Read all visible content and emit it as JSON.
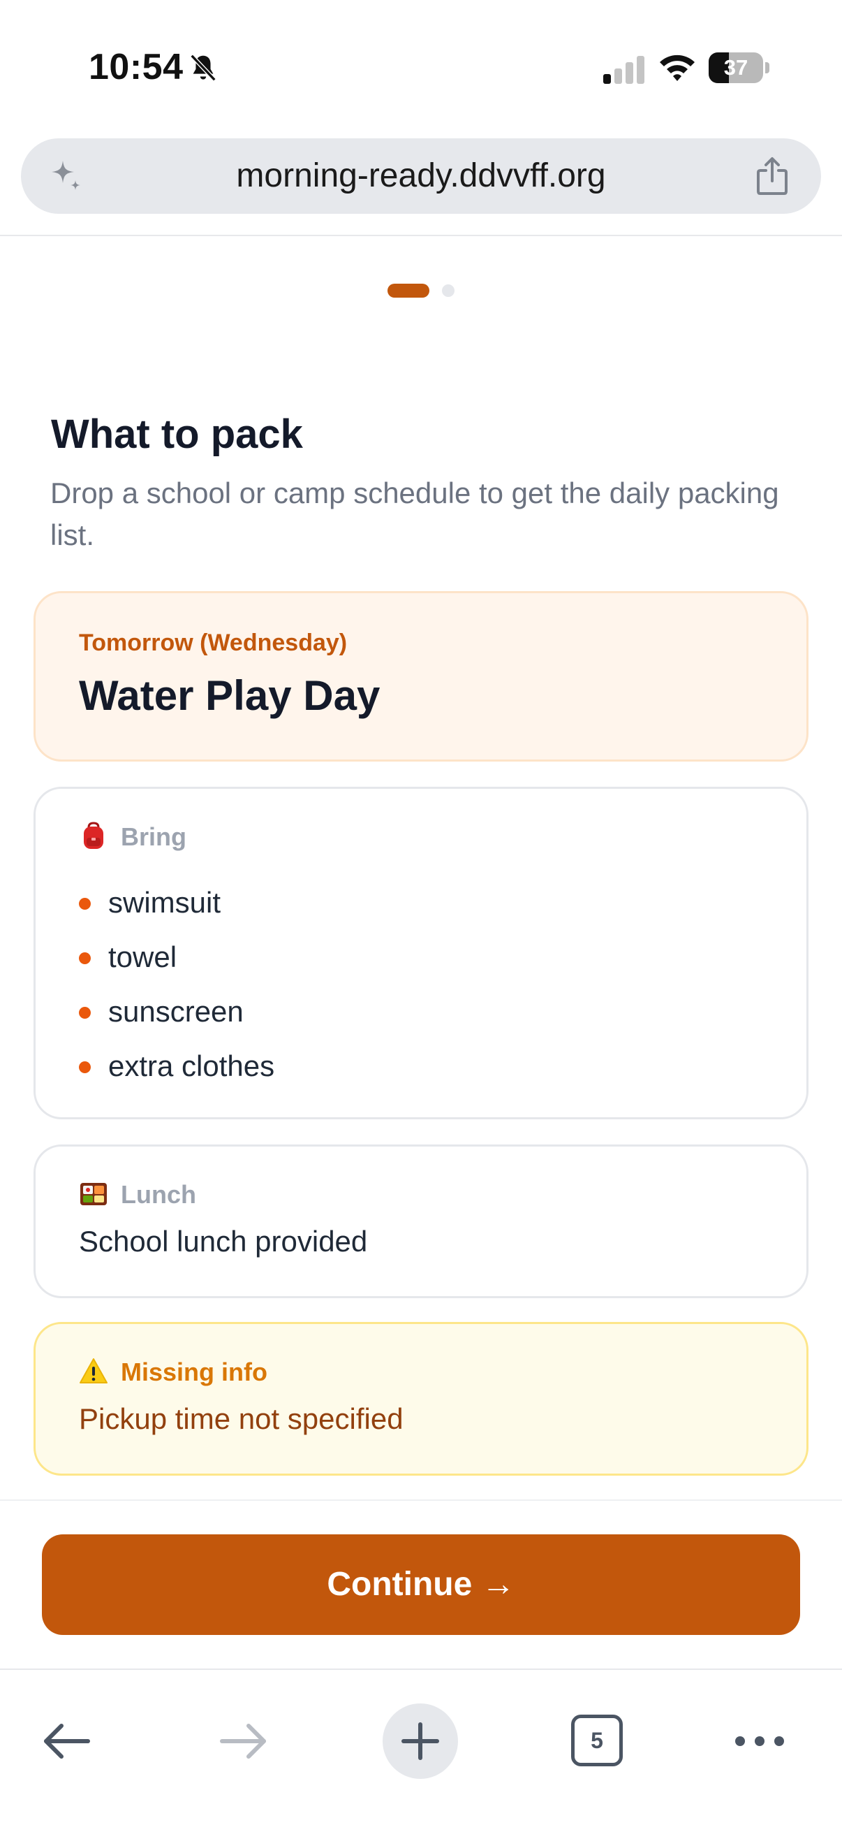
{
  "status_bar": {
    "time": "10:54",
    "battery_level": "37",
    "battery_fraction": 0.37
  },
  "browser": {
    "url": "morning-ready.ddvvff.org",
    "tab_count": "5",
    "icons": [
      "sparkle-icon",
      "share-icon",
      "back-arrow-icon",
      "forward-arrow-icon",
      "plus-icon",
      "tabs-icon",
      "more-icon"
    ]
  },
  "pager": {
    "current": 1,
    "total": 2
  },
  "header": {
    "title": "What to pack",
    "subtitle": "Drop a school or camp schedule to get the daily packing list."
  },
  "day_card": {
    "label": "Tomorrow (Wednesday)",
    "title": "Water Play Day"
  },
  "bring": {
    "icon": "backpack-icon",
    "label": "Bring",
    "items": [
      "swimsuit",
      "towel",
      "sunscreen",
      "extra clothes"
    ]
  },
  "lunch": {
    "icon": "bento-box-icon",
    "label": "Lunch",
    "text": "School lunch provided"
  },
  "missing": {
    "icon": "warning-icon",
    "label": "Missing info",
    "text": "Pickup time not specified"
  },
  "continue_button": {
    "label": "Continue →"
  },
  "colors": {
    "accent": "#c2570c",
    "bullet": "#ea580c",
    "day_card_bg": "#fff5ec",
    "missing_bg": "#fefbea",
    "missing_text": "#92400e",
    "missing_label": "#d97706"
  }
}
